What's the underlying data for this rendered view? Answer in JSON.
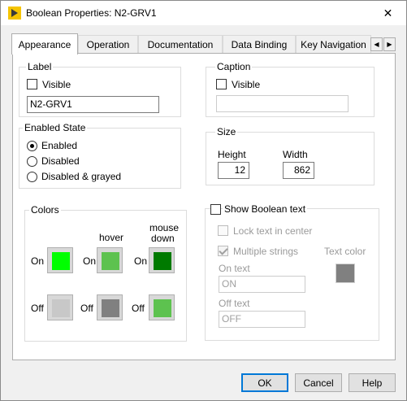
{
  "window": {
    "title": "Boolean Properties: N2-GRV1",
    "close_glyph": "✕"
  },
  "tabs": [
    {
      "label": "Appearance",
      "active": true
    },
    {
      "label": "Operation"
    },
    {
      "label": "Documentation"
    },
    {
      "label": "Data Binding"
    },
    {
      "label": "Key Navigation"
    }
  ],
  "tab_scroll": {
    "left": "◀",
    "right": "▶"
  },
  "label_group": {
    "title": "Label",
    "visible_label": "Visible",
    "visible_checked": false,
    "value": "N2-GRV1"
  },
  "caption_group": {
    "title": "Caption",
    "visible_label": "Visible",
    "visible_checked": false,
    "value": ""
  },
  "enabled_state": {
    "title": "Enabled State",
    "options": [
      "Enabled",
      "Disabled",
      "Disabled & grayed"
    ],
    "selected": "Enabled"
  },
  "size": {
    "title": "Size",
    "height_label": "Height",
    "height_value": "12",
    "width_label": "Width",
    "width_value": "862"
  },
  "colors": {
    "title": "Colors",
    "hover_label": "hover",
    "mouse_down_label_1": "mouse",
    "mouse_down_label_2": "down",
    "on_label": "On",
    "off_label": "Off",
    "swatches": {
      "on": "#00ff00",
      "on_hover": "#5dc24f",
      "on_mouse_down": "#007a00",
      "off": "#c8c8c8",
      "off_hover": "#808080",
      "off_mouse_down": "#5dc24f"
    }
  },
  "boolean_text": {
    "show_label": "Show Boolean text",
    "show_checked": false,
    "lock_label": "Lock text in center",
    "multiple_label": "Multiple strings",
    "multiple_checked": true,
    "text_color_label": "Text color",
    "text_color": "#808080",
    "on_text_label": "On text",
    "on_text_value": "ON",
    "off_text_label": "Off text",
    "off_text_value": "OFF"
  },
  "buttons": {
    "ok": "OK",
    "cancel": "Cancel",
    "help": "Help"
  }
}
